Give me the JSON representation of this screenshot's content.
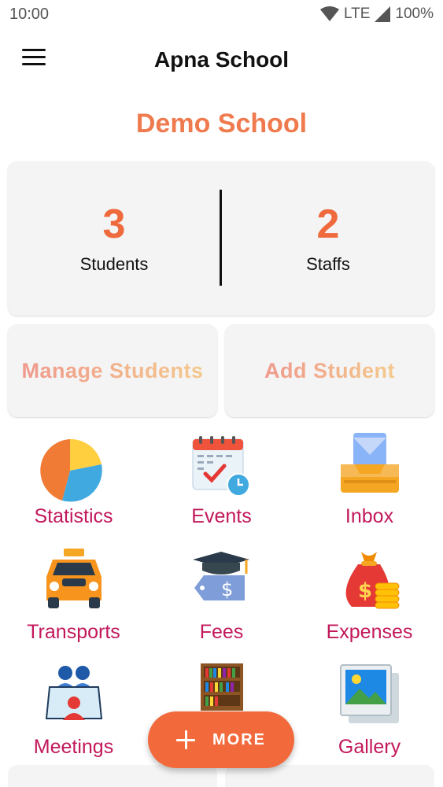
{
  "status_bar": {
    "time": "10:00",
    "network": "LTE",
    "battery": "100%"
  },
  "app_bar": {
    "title": "Apna School",
    "menu_icon": "hamburger-menu-icon"
  },
  "school_name": "Demo School",
  "stats": {
    "students": {
      "count": "3",
      "label": "Students"
    },
    "staffs": {
      "count": "2",
      "label": "Staffs"
    }
  },
  "actions": {
    "manage_students": "Manage Students",
    "add_student": "Add Student"
  },
  "grid": [
    {
      "label": "Statistics",
      "icon": "pie-chart-icon"
    },
    {
      "label": "Events",
      "icon": "calendar-icon"
    },
    {
      "label": "Inbox",
      "icon": "inbox-tray-icon"
    },
    {
      "label": "Transports",
      "icon": "taxi-icon"
    },
    {
      "label": "Fees",
      "icon": "graduation-fee-tag-icon"
    },
    {
      "label": "Expenses",
      "icon": "money-bag-icon"
    },
    {
      "label": "Meetings",
      "icon": "meeting-icon"
    },
    {
      "label": "",
      "icon": "bookshelf-icon"
    },
    {
      "label": "Gallery",
      "icon": "gallery-image-icon"
    }
  ],
  "fab": {
    "label": "MORE",
    "icon": "plus-icon"
  },
  "colors": {
    "accent": "#ef7a4e",
    "fab": "#f26a3c",
    "label": "#c2185b"
  }
}
